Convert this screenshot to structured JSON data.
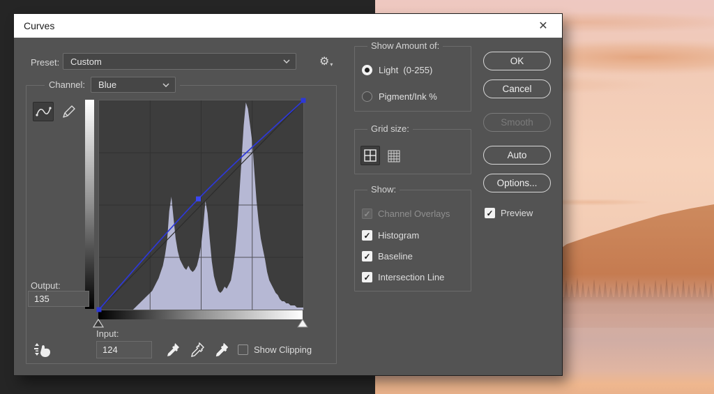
{
  "window": {
    "title": "Curves"
  },
  "icons": {
    "close": "✕",
    "gear": "⚙",
    "gear_caret": "▾",
    "check": "✓"
  },
  "preset": {
    "label": "Preset:",
    "value": "Custom"
  },
  "channel": {
    "label": "Channel:",
    "value": "Blue"
  },
  "output": {
    "label": "Output:",
    "value": "135"
  },
  "input_field": {
    "label": "Input:",
    "value": "124"
  },
  "show_clipping": {
    "label": "Show Clipping",
    "checked": false
  },
  "show_amount": {
    "legend": "Show Amount of:",
    "light_label": "Light  (0-255)",
    "pigment_label": "Pigment/Ink %",
    "selected": "light"
  },
  "grid_size": {
    "legend": "Grid size:",
    "selected": "quadrant"
  },
  "show_group": {
    "legend": "Show:",
    "channel_overlays": "Channel Overlays",
    "histogram": "Histogram",
    "baseline": "Baseline",
    "intersection": "Intersection Line"
  },
  "buttons": {
    "ok": "OK",
    "cancel": "Cancel",
    "smooth": "Smooth",
    "auto": "Auto",
    "options": "Options...",
    "preview": "Preview"
  },
  "colors": {
    "dialog_bg": "#535353",
    "titlebar_bg": "#ffffff",
    "plot_bg": "#3d3d3d",
    "histogram_fill": "#b6b8d4",
    "curve_blue": "#2d38d8",
    "photo_sky": "#f3ccb6",
    "photo_mountain": "#c97f52",
    "canvas_dark": "#252525"
  },
  "chart_data": {
    "type": "area",
    "title": "Blue channel histogram with tone curve",
    "x_range": [
      0,
      255
    ],
    "y_range_percent": [
      0,
      100
    ],
    "grid": "quarters",
    "histogram_percent": [
      0,
      0,
      0,
      0,
      0,
      0,
      0,
      0,
      0,
      0,
      0,
      0,
      0,
      0,
      0,
      0,
      0,
      1,
      2,
      3,
      4,
      5,
      6,
      7,
      8,
      9,
      11,
      13,
      15,
      18,
      21,
      26,
      33,
      47,
      54,
      44,
      34,
      28,
      24,
      22,
      20,
      19,
      21,
      19,
      18,
      19,
      21,
      25,
      31,
      40,
      52,
      46,
      34,
      23,
      16,
      12,
      9,
      8,
      9,
      11,
      10,
      12,
      14,
      20,
      28,
      40,
      56,
      72,
      88,
      99,
      96,
      88,
      80,
      66,
      52,
      42,
      34,
      29,
      24,
      18,
      14,
      12,
      10,
      8,
      7,
      5,
      4,
      4,
      3,
      3,
      2,
      2,
      2,
      1,
      1,
      1,
      1
    ],
    "curve_points": [
      {
        "input": 0,
        "output": 0
      },
      {
        "input": 124,
        "output": 135
      },
      {
        "input": 255,
        "output": 255
      }
    ],
    "selected_point": {
      "input": 124,
      "output": 135
    }
  }
}
